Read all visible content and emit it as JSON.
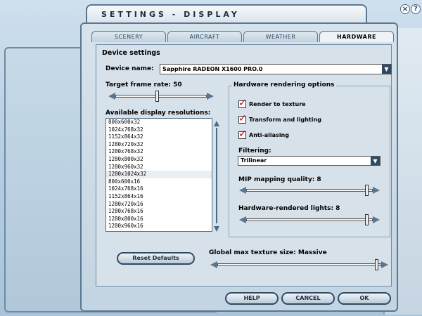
{
  "title": "SETTINGS - DISPLAY",
  "window_controls": {
    "close": "×",
    "help": "?"
  },
  "tabs": [
    {
      "label": "SCENERY",
      "active": false
    },
    {
      "label": "AIRCRAFT",
      "active": false
    },
    {
      "label": "WEATHER",
      "active": false
    },
    {
      "label": "HARDWARE",
      "active": true
    }
  ],
  "device": {
    "section_label": "Device settings",
    "name_label": "Device name:",
    "name_value": "Sapphire RADEON X1600 PRO.0"
  },
  "frame_rate": {
    "label": "Target frame rate: 50",
    "value": 50
  },
  "resolutions": {
    "label": "Available display resolutions:",
    "selected": "1280x1024x32",
    "items": [
      "800x600x32",
      "1024x768x32",
      "1152x864x32",
      "1280x720x32",
      "1280x768x32",
      "1280x800x32",
      "1280x960x32",
      "1280x1024x32",
      "800x600x16",
      "1024x768x16",
      "1152x864x16",
      "1280x720x16",
      "1280x768x16",
      "1280x800x16",
      "1280x960x16"
    ]
  },
  "hardware": {
    "section_label": "Hardware rendering options",
    "render_to_texture": {
      "label": "Render to texture",
      "checked": true
    },
    "transform_lighting": {
      "label": "Transform and lighting",
      "checked": true
    },
    "anti_aliasing": {
      "label": "Anti-aliasing",
      "checked": true
    },
    "filtering_label": "Filtering:",
    "filtering_value": "Trilinear",
    "mip_label": "MIP mapping quality: 8",
    "mip_value": 8,
    "lights_label": "Hardware-rendered lights: 8",
    "lights_value": 8
  },
  "texture": {
    "label": "Global max texture size: Massive",
    "value": "Massive"
  },
  "buttons": {
    "reset": "Reset Defaults",
    "help": "HELP",
    "cancel": "CANCEL",
    "ok": "OK"
  },
  "colors": {
    "accent": "#2f4a63",
    "checkmark": "#cc0000",
    "panel": "#d6e1ea"
  },
  "icons": {
    "dropdown": "triangle-down",
    "checkbox": "checkmark"
  }
}
